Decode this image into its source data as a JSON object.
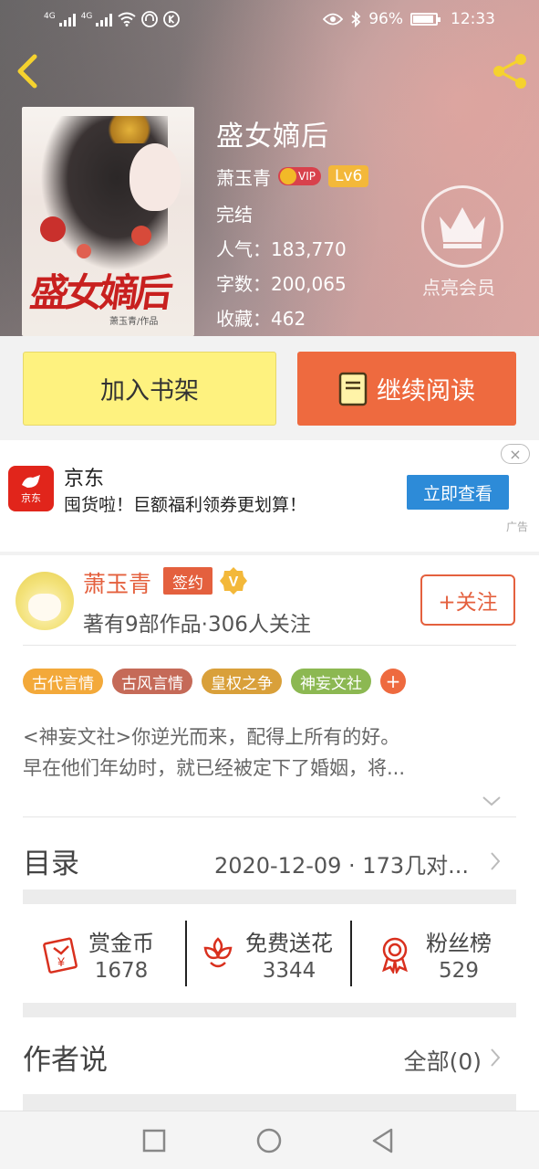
{
  "status_bar": {
    "signal1": "4G",
    "signal2": "4G",
    "battery": "96%",
    "time": "12:33"
  },
  "book": {
    "title": "盛女嫡后",
    "author": "萧玉青",
    "vip_label": "VIP",
    "level": "Lv6",
    "status": "完结",
    "popularity": "人气：183,770",
    "word_count": "字数：200,065",
    "favorites": "收藏：462",
    "cover_title": "盛女嫡后",
    "cover_author": "萧玉青/作品"
  },
  "member": {
    "label": "点亮会员"
  },
  "actions": {
    "shelf": "加入书架",
    "read": "继续阅读"
  },
  "ad": {
    "logo_text": "京东",
    "title": "京东",
    "description": "囤货啦！巨额福利领券更划算！",
    "button": "立即查看",
    "close": "×",
    "tag": "广告"
  },
  "author_card": {
    "name": "萧玉青",
    "signed_label": "签约",
    "verified_label": "V",
    "stats": "著有9部作品·306人关注",
    "follow": "+关注"
  },
  "tags": [
    {
      "label": "古代言情",
      "color": "#f3a93a"
    },
    {
      "label": "古风言情",
      "color": "#c56a58"
    },
    {
      "label": "皇权之争",
      "color": "#d9a03a"
    },
    {
      "label": "神妄文社",
      "color": "#8cb852"
    }
  ],
  "tag_add": "+",
  "description": {
    "line1": "<神妄文社>你逆光而来，配得上所有的好。",
    "line2": "早在他们年幼时，就已经被定下了婚姻，将..."
  },
  "toc": {
    "label": "目录",
    "latest": "2020-12-09 · 173几对..."
  },
  "stats": [
    {
      "label": "赏金币",
      "value": "1678",
      "icon": "red-envelope-icon"
    },
    {
      "label": "免费送花",
      "value": "3344",
      "icon": "flower-icon"
    },
    {
      "label": "粉丝榜",
      "value": "529",
      "icon": "medal-icon"
    }
  ],
  "author_say": {
    "label": "作者说",
    "all": "全部(0)"
  },
  "colors": {
    "accent": "#ee6a3f",
    "shelf_yellow": "#fef27f",
    "ad_blue": "#2d8bd8",
    "jd_red": "#e1251b"
  }
}
